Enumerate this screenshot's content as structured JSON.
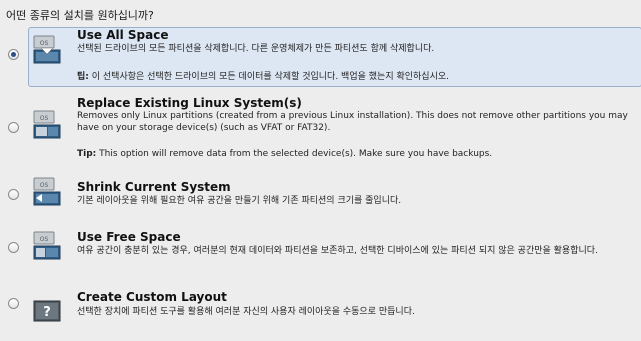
{
  "question": "어떤 종류의 설치를 원하십니까?",
  "options": [
    {
      "title": "Use All Space",
      "description": "선택된 드라이브의 모든 파티션을 삭제합니다. 다른 운영체제가 만든 파티션도 함께 삭제합니다.",
      "tip_label": "팁:",
      "tip_text": " 이 선택사항은 선택한 드라이브의 모든 데이터를 삭제할 것입니다. 백업을 했는지 확인하십시오.",
      "selected": true,
      "icon": "disk-all-space-icon"
    },
    {
      "title": "Replace Existing Linux System(s)",
      "description": "Removes only Linux partitions (created from a previous Linux installation).  This does not remove other partitions you may have on your storage device(s) (such as VFAT or FAT32).",
      "tip_label": "Tip:",
      "tip_text": " This option will remove data from the selected device(s).  Make sure you have backups.",
      "selected": false,
      "icon": "disk-replace-linux-icon"
    },
    {
      "title": "Shrink Current System",
      "description": "기본 레이아웃을 위해 필요한 여유 공간을 만들기 위해 기존 파티션의 크기를 줄입니다.",
      "selected": false,
      "icon": "disk-shrink-icon"
    },
    {
      "title": "Use Free Space",
      "description": "여유 공간이 충분히 있는 경우, 여러분의 현재 데이터와 파티션을 보존하고, 선택한 디바이스에 있는 파티션 되지 않은 공간만을 활용합니다.",
      "selected": false,
      "icon": "disk-free-space-icon"
    },
    {
      "title": "Create Custom Layout",
      "description": "선택한 장치에 파티션 도구를 활용해 여러분 자신의 사용자 레이아웃을 수동으로 만듭니다.",
      "selected": false,
      "icon": "custom-layout-icon"
    }
  ],
  "icon_label_os": "OS",
  "icon_label_custom": "?"
}
